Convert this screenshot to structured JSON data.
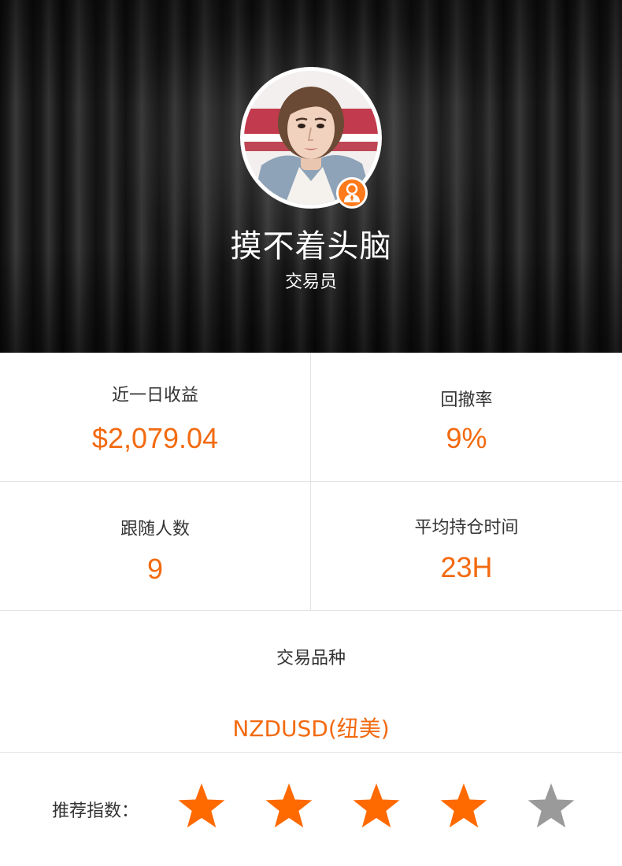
{
  "profile": {
    "name": "摸不着头脑",
    "role": "交易员",
    "avatar_icon": "avatar-photo",
    "badge_icon": "trader-person-icon"
  },
  "stats": {
    "daily_profit_label": "近一日收益",
    "daily_profit_value": "$2,079.04",
    "drawdown_label": "回撤率",
    "drawdown_value": "9%",
    "followers_label": "跟随人数",
    "followers_value": "9",
    "avg_hold_label": "平均持仓时间",
    "avg_hold_value": "23H"
  },
  "variety": {
    "label": "交易品种",
    "value": "NZDUSD(纽美)"
  },
  "rating": {
    "label": "推荐指数：",
    "stars_filled": 4,
    "stars_total": 5
  },
  "colors": {
    "accent": "#f26a10",
    "star_filled": "#ff6a00",
    "star_empty": "#9a9a9a",
    "divider": "#e3e3e3"
  }
}
